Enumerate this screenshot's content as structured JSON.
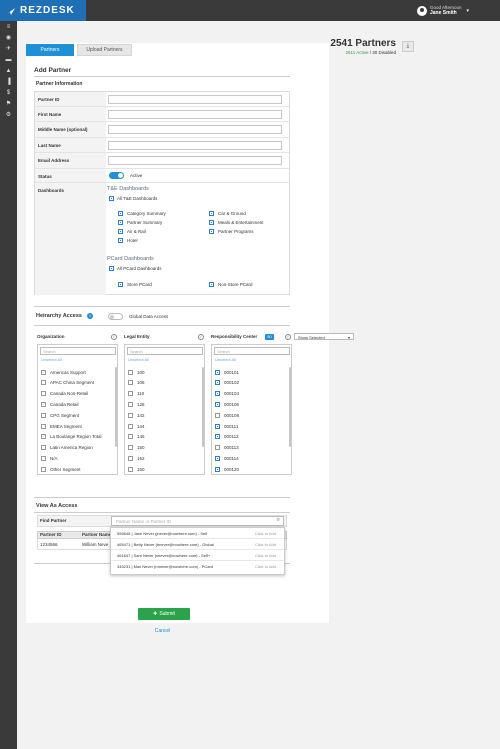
{
  "app": {
    "logo_text": "REZDESK"
  },
  "user": {
    "greeting": "Good Afternoon",
    "name": "Jane Smith",
    "caret": "▾"
  },
  "sidebar": {
    "icons": [
      "≡",
      "◉",
      "✈",
      "▬",
      "▲",
      "▐",
      "$",
      "⚑",
      "⚙"
    ]
  },
  "tabs": [
    {
      "label": "Partners"
    },
    {
      "label": "Upload Partners"
    }
  ],
  "summary": {
    "count": "2541 Partners",
    "active": "2511 Active",
    "disabled": " / 30 Disabled"
  },
  "form": {
    "title": "Add Partner",
    "section": "Partner Information",
    "fields": [
      {
        "label": "Partner ID",
        "value": ""
      },
      {
        "label": "First Name",
        "value": ""
      },
      {
        "label": "Middle Name (optional)",
        "value": ""
      },
      {
        "label": "Last Name",
        "value": ""
      },
      {
        "label": "Email Address",
        "value": ""
      }
    ],
    "status_label": "Status",
    "status_value": "Active",
    "dashboards_label": "Dashboards",
    "te": {
      "header": "T&E Dashboards",
      "all": "All T&E Dashboards",
      "col1": [
        "Category Summary",
        "Partner Summary",
        "Air & Rail",
        "Hotel"
      ],
      "col2": [
        "Car & Ground",
        "Meals & Entertainment",
        "Partner Programs"
      ]
    },
    "pcard": {
      "header": "PCard Dashboards",
      "all": "All PCard Dashboards",
      "col1": [
        "Store PCard"
      ],
      "col2": [
        "Non-Store PCard"
      ]
    }
  },
  "hierarchy": {
    "title": "Heirarchy Access",
    "global": "Global Data Access",
    "org": {
      "title": "Organization",
      "search": "Search",
      "unselect": "Unselect All",
      "items": [
        {
          "l": "Americas Support",
          "c": false
        },
        {
          "l": "APAC China Segment",
          "c": false
        },
        {
          "l": "Canada Non-Retail",
          "c": false
        },
        {
          "l": "Canada Retail",
          "c": false
        },
        {
          "l": "CPG Segment",
          "c": false
        },
        {
          "l": "EMEA Segment",
          "c": false
        },
        {
          "l": "La Boulange Region Total",
          "c": false
        },
        {
          "l": "Latin America Region",
          "c": false
        },
        {
          "l": "N/A",
          "c": false
        },
        {
          "l": "Other Segment",
          "c": false
        }
      ]
    },
    "le": {
      "title": "Legal Entity",
      "search": "Search",
      "unselect": "Unselect All",
      "items": [
        {
          "l": "100",
          "c": false
        },
        {
          "l": "108",
          "c": false
        },
        {
          "l": "110",
          "c": false
        },
        {
          "l": "128",
          "c": false
        },
        {
          "l": "142",
          "c": false
        },
        {
          "l": "144",
          "c": false
        },
        {
          "l": "146",
          "c": false
        },
        {
          "l": "150",
          "c": false
        },
        {
          "l": "152",
          "c": false
        },
        {
          "l": "160",
          "c": false
        }
      ]
    },
    "rc": {
      "title": "Responsibility Center",
      "badge": "50",
      "show": "Show Selected",
      "search": "Search",
      "unselect": "Unselect All",
      "items": [
        {
          "l": "000101",
          "c": true
        },
        {
          "l": "000102",
          "c": true
        },
        {
          "l": "000104",
          "c": true
        },
        {
          "l": "000106",
          "c": true
        },
        {
          "l": "000109",
          "c": false
        },
        {
          "l": "000111",
          "c": true
        },
        {
          "l": "000112",
          "c": true
        },
        {
          "l": "000113",
          "c": false
        },
        {
          "l": "000114",
          "c": true
        },
        {
          "l": "000120",
          "c": true
        }
      ]
    }
  },
  "view_as": {
    "title": "View As Access",
    "find_label": "Find Partner",
    "find_placeholder": "Partner Name or Partner ID",
    "col_id": "Partner ID",
    "col_name": "Partner Name",
    "row_id": "1234566",
    "row_name": "William Neve",
    "suggestions": [
      {
        "t": "555645 | Jane Never (jnever@nowhere.com) - Self",
        "a": "Click to Add"
      },
      {
        "t": "465471 | Betty Never (bnever@nowhere.com) - Global",
        "a": "Click to Add"
      },
      {
        "t": "461647 | Sam Never (snever@nowhere.com) - Self+",
        "a": "Click to Add"
      },
      {
        "t": "345231 | Max Never (mnever@nowhere.com) - PCard",
        "a": "Click to Add"
      }
    ]
  },
  "actions": {
    "submit": "Submit",
    "cancel": "Cancel"
  }
}
